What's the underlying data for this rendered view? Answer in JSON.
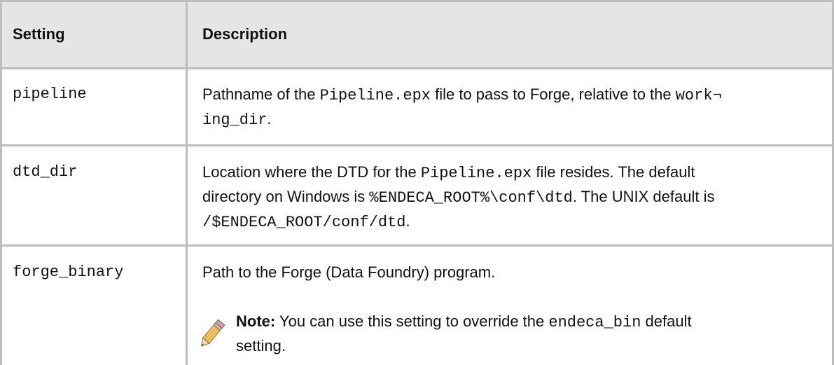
{
  "table": {
    "headers": {
      "setting": "Setting",
      "description": "Description"
    },
    "rows": [
      {
        "setting": "pipeline",
        "desc": {
          "t1": "Pathname of the ",
          "c1": "Pipeline.epx",
          "t2": " file to pass to Forge, relative to the ",
          "c2": "work¬",
          "c3": "ing_dir",
          "t3": "."
        }
      },
      {
        "setting": "dtd_dir",
        "desc": {
          "t1": "Location where the DTD for the ",
          "c1": "Pipeline.epx",
          "t2": " file resides. The default",
          "t3": "directory on Windows is ",
          "c2": "%ENDECA_ROOT%\\conf\\dtd",
          "t4": ". The UNIX default is",
          "c3": "/$ENDECA_ROOT/conf/dtd",
          "t5": "."
        }
      },
      {
        "setting": "forge_binary",
        "desc": {
          "t1": "Path to the Forge (Data Foundry) program.",
          "note_label": "Note:",
          "note_t1": " You can use this setting to override the ",
          "note_code": "endeca_bin",
          "note_t2": " default",
          "note_t3": "setting."
        }
      }
    ]
  },
  "icons": {
    "note": "pencil-icon"
  },
  "colors": {
    "header_bg": "#e5e5e5",
    "border": "#bdbdbd"
  }
}
